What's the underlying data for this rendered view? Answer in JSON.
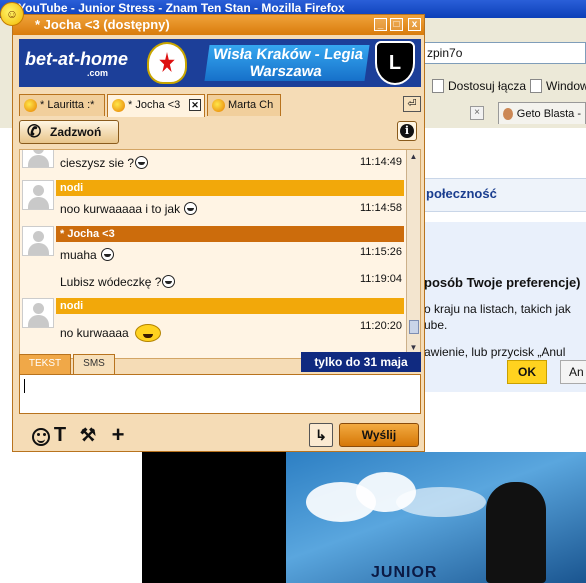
{
  "browser": {
    "title": "YouTube - Junior Stress - Znam Ten Stan - Mozilla Firefox",
    "url_fragment": "zpin7o",
    "bookmarks": [
      "Dostosuj łącza",
      "Window"
    ],
    "tab_label": "Geto Blasta -",
    "nav_label": "połeczność",
    "dialog_title": "posób Twoje preferencje)",
    "dialog_line1": "o kraju na listach, takich jak",
    "dialog_line2": "ube.",
    "dialog_line3": "awienie, lub przycisk „Anul",
    "ok_label": "OK",
    "cancel_label": "An",
    "poster_text": "JUNIOR"
  },
  "window": {
    "title": "* Jocha <3 (dostępny)",
    "buttons": {
      "minimize": "_",
      "maximize": "□",
      "close": "x"
    }
  },
  "banner": {
    "brand": "bet-at-home",
    "brand_sub": ".com",
    "match": "Wisła Kraków - Legia Warszawa",
    "shield_letter": "L"
  },
  "tabs": [
    {
      "label": "* Lauritta :*"
    },
    {
      "label": "* Jocha <3"
    },
    {
      "label": "Marta Ch"
    }
  ],
  "tabs_menu": "⏎",
  "call_label": "Zadzwoń",
  "messages": [
    {
      "text": "cieszysz sie ?",
      "time": "11:14:49"
    },
    {
      "sender": "nodi",
      "text": "noo kurwaaaaa i to jak",
      "time": "11:14:58"
    },
    {
      "sender": "* Jocha <3",
      "text": "muaha",
      "time": "11:15:26"
    },
    {
      "text": "Lubisz wódeczkę ?",
      "time": "11:19:04"
    },
    {
      "sender": "nodi",
      "text": "no kurwaaaa",
      "time": "11:20:20"
    }
  ],
  "mode_tabs": {
    "text": "TEKST",
    "sms": "SMS"
  },
  "promo": "tylko do 31 maja",
  "input_value": "",
  "send_label": "Wyślij",
  "enter_label": "↳",
  "tools": {
    "format": "T",
    "plus": "+"
  },
  "colors": {
    "window_orange": "#d97c0c",
    "header_other": "#f2a80a",
    "header_self": "#cc6c0c",
    "chat_bg": "#fff4e4",
    "promo_bg": "#102a80"
  }
}
